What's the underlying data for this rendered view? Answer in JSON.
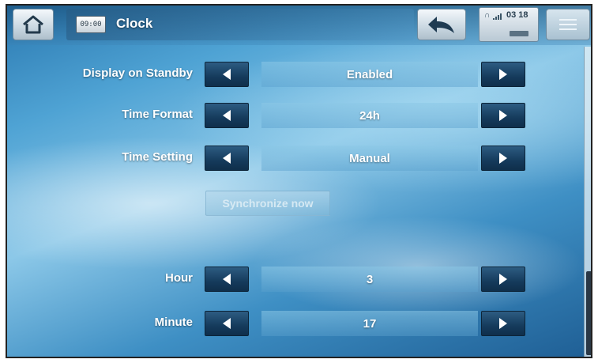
{
  "header": {
    "app_title": "Clock",
    "clock_icon_text": "09:00",
    "status_time": "03 18",
    "icons": [
      "home-icon",
      "clock-icon",
      "back-arrow-icon",
      "headphone-icon",
      "signal-icon",
      "battery-icon",
      "menu-icon"
    ]
  },
  "settings": {
    "display_on_standby": {
      "label": "Display on Standby",
      "value": "Enabled"
    },
    "time_format": {
      "label": "Time Format",
      "value": "24h"
    },
    "time_setting": {
      "label": "Time Setting",
      "value": "Manual"
    },
    "synchronize_label": "Synchronize now",
    "hour": {
      "label": "Hour",
      "value": "3"
    },
    "minute": {
      "label": "Minute",
      "value": "17"
    }
  },
  "colors": {
    "arrow_button": "#153b5c",
    "background_mid": "#4fa3d4",
    "label_text": "#ffffff"
  }
}
